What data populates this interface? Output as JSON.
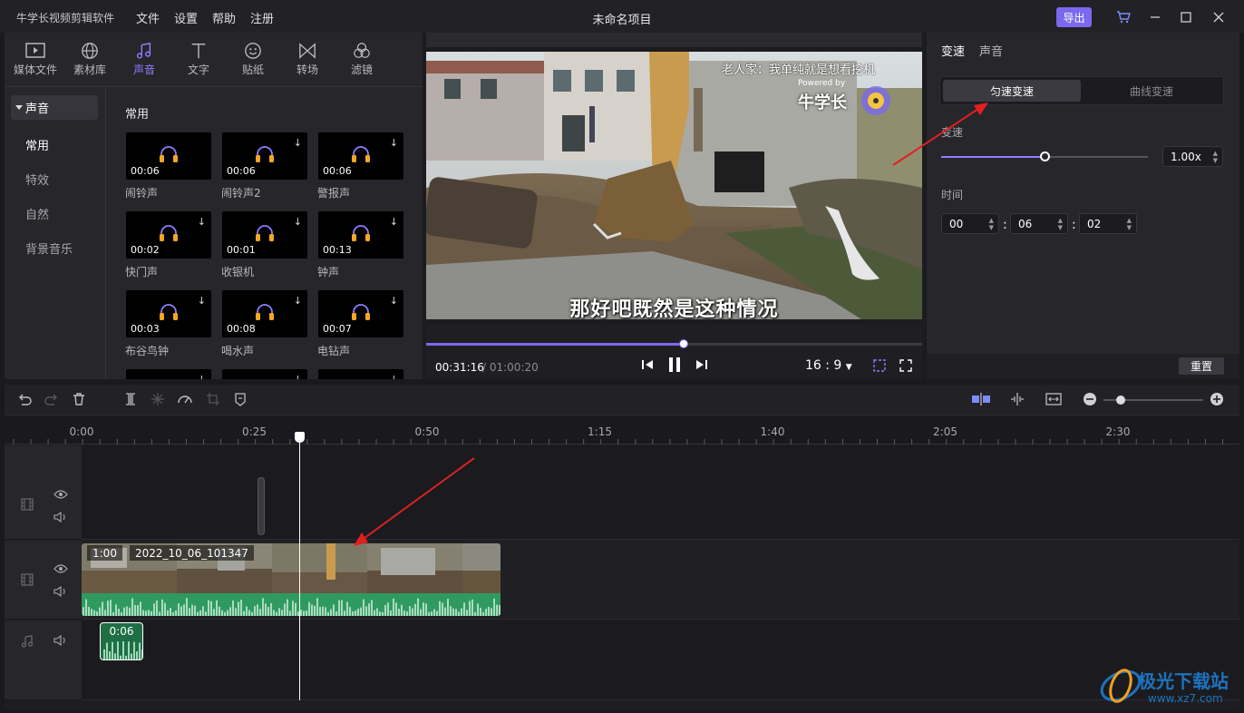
{
  "app": {
    "name": "牛学长视频剪辑软件",
    "menu": [
      "文件",
      "设置",
      "帮助",
      "注册"
    ],
    "project_title": "未命名项目",
    "export_label": "导出"
  },
  "tool_tabs": [
    {
      "label": "媒体文件",
      "icon": "media-icon"
    },
    {
      "label": "素材库",
      "icon": "globe-icon"
    },
    {
      "label": "声音",
      "icon": "music-note-icon",
      "active": true
    },
    {
      "label": "文字",
      "icon": "text-icon"
    },
    {
      "label": "贴纸",
      "icon": "sticker-icon"
    },
    {
      "label": "转场",
      "icon": "transition-icon"
    },
    {
      "label": "滤镜",
      "icon": "filter-icon"
    }
  ],
  "categories": {
    "header": "声音",
    "items": [
      "常用",
      "特效",
      "自然",
      "背景音乐"
    ]
  },
  "sound_section_title": "常用",
  "sounds": [
    {
      "name": "闹铃声",
      "duration": "00:06"
    },
    {
      "name": "闹铃声2",
      "duration": "00:06"
    },
    {
      "name": "警报声",
      "duration": "00:06"
    },
    {
      "name": "快门声",
      "duration": "00:02"
    },
    {
      "name": "收银机",
      "duration": "00:01"
    },
    {
      "name": "钟声",
      "duration": "00:13"
    },
    {
      "name": "布谷鸟钟",
      "duration": "00:03"
    },
    {
      "name": "喝水声",
      "duration": "00:08"
    },
    {
      "name": "电钻声",
      "duration": "00:07"
    }
  ],
  "preview": {
    "subtitle": "那好吧既然是这种情况",
    "watermark_text": "老人家：我单纯就是想看挖机",
    "watermark_small": "Powered by",
    "watermark_logo": "牛学长",
    "current_time": "00:31:16",
    "total_time": "/ 01:00:20",
    "progress": 0.52,
    "aspect_ratio": "16 : 9"
  },
  "right_panel": {
    "tabs": [
      "变速",
      "声音"
    ],
    "modes": [
      "匀速变速",
      "曲线变速"
    ],
    "speed_label": "变速",
    "speed_value": "1.00x",
    "speed_fraction": 0.5,
    "time_label": "时间",
    "time_hh": "00",
    "time_mm": "06",
    "time_ss": "02",
    "reset_label": "重置"
  },
  "timeline": {
    "ruler": [
      "0:00",
      "0:25",
      "0:50",
      "1:15",
      "1:40",
      "2:05",
      "2:30"
    ],
    "clip_duration": "1:00",
    "clip_name": "2022_10_06_101347",
    "audio_clip_duration": "0:06"
  },
  "site": {
    "name": "极光下载站",
    "url": "www.xz7.com"
  },
  "colors": {
    "accent": "#7b68ee",
    "audio_wave": "#2f9a5f",
    "arrow": "#e02020"
  }
}
